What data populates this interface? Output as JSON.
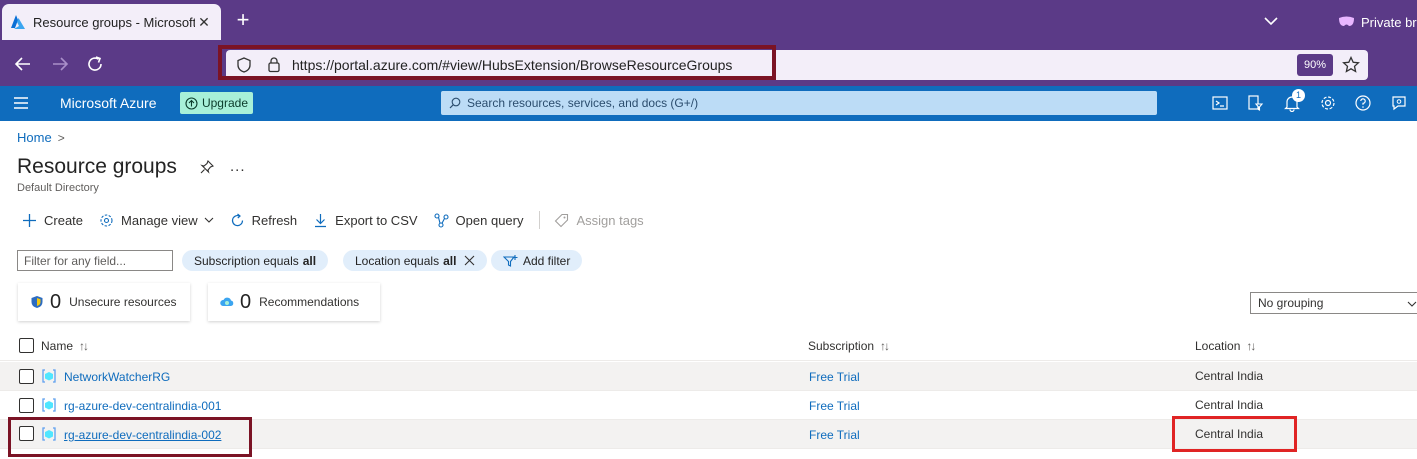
{
  "browser": {
    "tab_title": "Resource groups - Microsoft Az",
    "new_tab_symbol": "+",
    "private_label": "Private bro",
    "url": "https://portal.azure.com/#view/HubsExtension/BrowseResourceGroups",
    "zoom": "90%"
  },
  "azure_bar": {
    "brand": "Microsoft Azure",
    "upgrade_label": "Upgrade",
    "search_placeholder": "Search resources, services, and docs (G+/)",
    "notification_count": "1"
  },
  "breadcrumb": {
    "home": "Home",
    "separator": ">"
  },
  "page": {
    "title": "Resource groups",
    "subtitle": "Default Directory",
    "more": "..."
  },
  "toolbar": {
    "create": "Create",
    "manage_view": "Manage view",
    "refresh": "Refresh",
    "export": "Export to CSV",
    "open_query": "Open query",
    "assign_tags": "Assign tags"
  },
  "filters": {
    "placeholder": "Filter for any field...",
    "subscription_label": "Subscription equals",
    "subscription_value": "all",
    "location_label": "Location equals",
    "location_value": "all",
    "add_filter": "Add filter"
  },
  "cards": {
    "unsecure_count": "0",
    "unsecure_label": "Unsecure resources",
    "recommend_count": "0",
    "recommend_label": "Recommendations"
  },
  "grouping": {
    "selected": "No grouping"
  },
  "table": {
    "headers": {
      "name": "Name",
      "subscription": "Subscription",
      "location": "Location"
    },
    "sort_symbol": "↑↓",
    "rows": [
      {
        "name": "NetworkWatcherRG",
        "subscription": "Free Trial",
        "location": "Central India"
      },
      {
        "name": "rg-azure-dev-centralindia-001",
        "subscription": "Free Trial",
        "location": "Central India"
      },
      {
        "name": "rg-azure-dev-centralindia-002",
        "subscription": "Free Trial",
        "location": "Central India"
      }
    ]
  },
  "colors": {
    "browser_chrome": "#5b3a87",
    "azure_blue": "#0f6cbd",
    "highlight_dark_red": "#7b1325",
    "highlight_red": "#e02424"
  }
}
